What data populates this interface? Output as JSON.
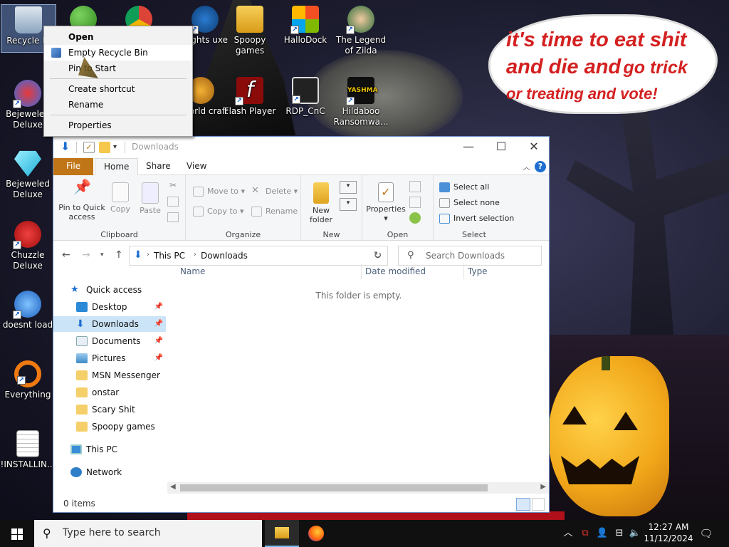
{
  "desktop": {
    "icons": [
      {
        "label": "Recycle Bi",
        "icon": "recycle-bin-icon"
      },
      {
        "label": "",
        "icon": "people-icon"
      },
      {
        "label": "",
        "icon": "chrome-icon"
      },
      {
        "label": "Nights uxe",
        "icon": "game-icon"
      },
      {
        "label": "Spoopy games",
        "icon": "folder-icon"
      },
      {
        "label": "HalloDock",
        "icon": "windows-logo-icon"
      },
      {
        "label": "The Legend of Zilda",
        "icon": "game-character-icon"
      },
      {
        "label": "Bejeweled Deluxe",
        "icon": "gem-icon"
      },
      {
        "label": "e World craft",
        "icon": "game-icon"
      },
      {
        "label": "Flash Player",
        "icon": "flash-icon"
      },
      {
        "label": "RDP_CnC",
        "icon": "remote-desktop-icon"
      },
      {
        "label": "Hildaboo Ransomwa...",
        "icon": "shield-icon"
      },
      {
        "label": "Bejeweled Deluxe",
        "icon": "diamond-icon"
      },
      {
        "label": "Chuzzle Deluxe",
        "icon": "chuzzle-icon"
      },
      {
        "label": "doesnt load",
        "icon": "thunderbird-icon"
      },
      {
        "label": "Everything",
        "icon": "search-icon"
      },
      {
        "label": "!INSTALLIN...",
        "icon": "document-icon"
      }
    ],
    "yashma_label": "YASHMA",
    "speech": {
      "line1": "it's time to eat shit",
      "line2a": "and die and",
      "line2b": "go trick",
      "line3": "or treating and vote!"
    }
  },
  "context_menu": {
    "items": [
      "Open",
      "Empty Recycle Bin",
      "Pin to Start",
      "Create shortcut",
      "Rename",
      "Properties"
    ]
  },
  "explorer": {
    "title": "Downloads",
    "window_buttons": {
      "minimize": "—",
      "maximize": "☐",
      "close": "✕"
    },
    "tabs": {
      "file": "File",
      "home": "Home",
      "share": "Share",
      "view": "View"
    },
    "ribbon": {
      "clipboard": {
        "label": "Clipboard",
        "pin": "Pin to Quick access",
        "copy": "Copy",
        "paste": "Paste"
      },
      "organize": {
        "label": "Organize",
        "move_to": "Move to",
        "copy_to": "Copy to",
        "delete": "Delete",
        "rename": "Rename"
      },
      "new": {
        "label": "New",
        "new_folder": "New folder"
      },
      "open": {
        "label": "Open",
        "properties": "Properties"
      },
      "select": {
        "label": "Select",
        "select_all": "Select all",
        "select_none": "Select none",
        "invert": "Invert selection"
      }
    },
    "address": {
      "crumbs": [
        "This PC",
        "Downloads"
      ],
      "search_placeholder": "Search Downloads"
    },
    "nav": {
      "quick_access": "Quick access",
      "pinned": [
        {
          "label": "Desktop",
          "icon": "desktop-icon"
        },
        {
          "label": "Downloads",
          "icon": "download-arrow-icon"
        },
        {
          "label": "Documents",
          "icon": "documents-icon"
        },
        {
          "label": "Pictures",
          "icon": "pictures-icon"
        }
      ],
      "folders": [
        "MSN Messenger",
        "onstar",
        "Scary Shit",
        "Spoopy games"
      ],
      "this_pc": "This PC",
      "network": "Network"
    },
    "columns": [
      "Name",
      "Date modified",
      "Type"
    ],
    "empty_message": "This folder is empty.",
    "status": "0 items"
  },
  "taskbar": {
    "search_placeholder": "Type here to search",
    "time": "12:27 AM",
    "date": "11/12/2024"
  },
  "colors": {
    "file_tab": "#c07516",
    "accent": "#1e6fd0",
    "selection": "#cce4f7",
    "speech_text": "#d42020"
  }
}
